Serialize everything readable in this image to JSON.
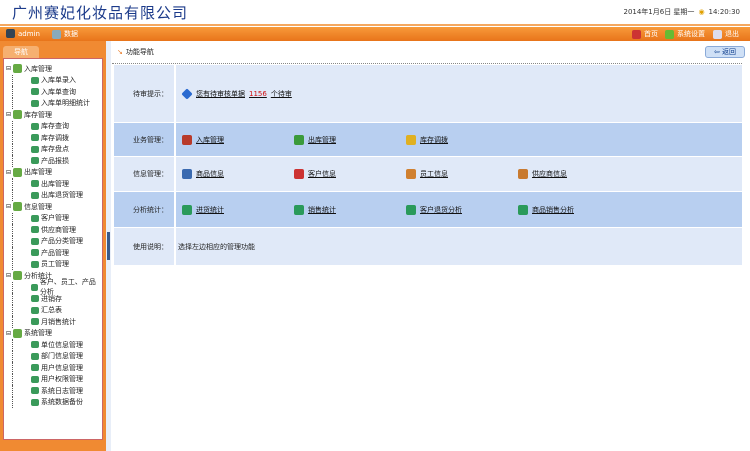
{
  "header": {
    "company": "广州赛妃化妆品有限公司",
    "date": "2014年1月6日 星期一",
    "time": "14:20:30"
  },
  "topbar": {
    "user": "admin",
    "role": "数据",
    "links": [
      "首页",
      "系统设置",
      "退出"
    ]
  },
  "sidebar": {
    "tab": "导航",
    "groups": [
      {
        "label": "入库管理",
        "items": [
          "入库单录入",
          "入库单查询",
          "入库单明细统计"
        ]
      },
      {
        "label": "库存管理",
        "items": [
          "库存查询",
          "库存调拨",
          "库存盘点",
          "产品报损"
        ]
      },
      {
        "label": "出库管理",
        "items": [
          "出库管理",
          "出库退货管理"
        ]
      },
      {
        "label": "信息管理",
        "items": [
          "客户管理",
          "供应商管理",
          "产品分类管理",
          "产品管理",
          "员工管理"
        ]
      },
      {
        "label": "分析统计",
        "items": [
          "客户、员工、产品分析",
          "进销存",
          "汇总表",
          "月销售统计"
        ]
      },
      {
        "label": "系统管理",
        "items": [
          "单位信息管理",
          "部门信息管理",
          "用户信息管理",
          "用户权限管理",
          "系统日志管理",
          "系统数据备份"
        ]
      }
    ]
  },
  "main": {
    "breadcrumb": "功能导航",
    "back": "返回",
    "pending": {
      "label": "待审提示：",
      "text": "您有待审核单据",
      "count": "1156",
      "suffix": "个待审"
    },
    "business": {
      "label": "业务管理：",
      "links": [
        "入库管理",
        "出库管理",
        "库存调拨"
      ]
    },
    "info": {
      "label": "信息管理：",
      "links": [
        "商品信息",
        "客户信息",
        "员工信息",
        "供应商信息"
      ]
    },
    "stats": {
      "label": "分析统计：",
      "links": [
        "进货统计",
        "销售统计",
        "客户退货分析",
        "商品销售分析"
      ]
    },
    "help": {
      "label": "使用说明：",
      "text": "选择左边相应的管理功能"
    }
  },
  "colors": {
    "orange": "#e8741a",
    "rowLight": "#e0e9f8",
    "rowDark": "#b8cff0",
    "alert": "#d01010"
  }
}
